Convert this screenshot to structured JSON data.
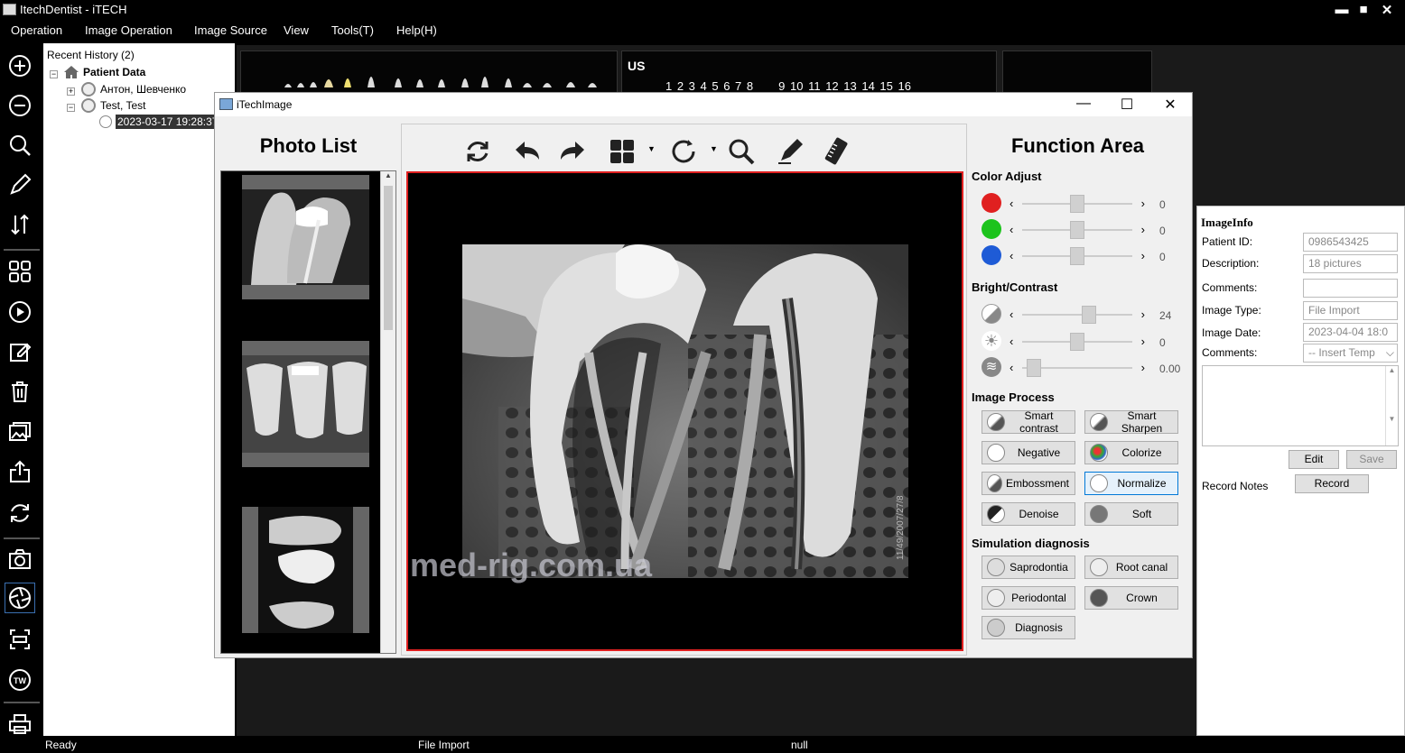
{
  "window": {
    "title": "ItechDentist - iTECH",
    "minimize": "▬",
    "maximize": "■",
    "close": "✕"
  },
  "menu": [
    "Operation",
    "Image Operation",
    "Image Source",
    "View",
    "Tools(T)",
    "Help(H)"
  ],
  "left_toolbar": [
    "add-icon",
    "zoom-out-icon",
    "search-icon",
    "pencil-icon",
    "sort-icon",
    "grid-icon",
    "play-icon",
    "edit-icon",
    "trash-icon",
    "gallery-icon",
    "export-icon",
    "refresh-icon",
    "camera-icon",
    "aperture-icon",
    "scanner-icon",
    "tw-icon",
    "printer-icon"
  ],
  "tree": {
    "header": "Recent History (2)",
    "root": "Patient Data",
    "patients": [
      "Антон, Шевченко",
      "Test, Test"
    ],
    "selected_date": "2023-03-17 19:28:37"
  },
  "preview": {
    "region": "US",
    "teeth_numbers": "1 2 3 4 5 6 7 8     9 10 11 12 13 14 15 16"
  },
  "dialog": {
    "title": "iTechImage",
    "photo_list_title": "Photo List",
    "function_area_title": "Function Area",
    "toolbar": [
      "refresh-icon",
      "undo-icon",
      "redo-icon",
      "layout-grid-icon",
      "rotate-icon",
      "magnifier-icon",
      "draw-icon",
      "ruler-icon"
    ],
    "watermark": "med-rig.com.ua",
    "color_adjust": {
      "label": "Color Adjust",
      "rows": [
        {
          "color": "#e02020",
          "value": "0",
          "level": 0.5
        },
        {
          "color": "#1cc31c",
          "value": "0",
          "level": 0.5
        },
        {
          "color": "#1e5bd6",
          "value": "0",
          "level": 0.5
        }
      ]
    },
    "bright_contrast": {
      "label": "Bright/Contrast",
      "rows": [
        {
          "icon": "contrast-icon",
          "value": "24",
          "level": 0.62
        },
        {
          "icon": "brightness-icon",
          "value": "0",
          "level": 0.5
        },
        {
          "icon": "gamma-icon",
          "value": "0.00",
          "level": 0.05
        }
      ]
    },
    "image_process": {
      "label": "Image Process",
      "buttons": [
        "Smart contrast",
        "Smart Sharpen",
        "Negative",
        "Colorize",
        "Embossment",
        "Normalize",
        "Denoise",
        "Soft"
      ]
    },
    "simulation": {
      "label": "Simulation diagnosis",
      "buttons": [
        "Saprodontia",
        "Root canal",
        "Periodontal",
        "Crown",
        "Diagnosis"
      ]
    },
    "window_controls": {
      "minimize": "—",
      "maximize": "☐",
      "close": "✕"
    }
  },
  "image_info": {
    "title": "ImageInfo",
    "fields": [
      {
        "label": "Patient ID:",
        "value": "0986543425"
      },
      {
        "label": "Description:",
        "value": "18 pictures"
      },
      {
        "label": "Comments:",
        "value": ""
      },
      {
        "label": "Image Type:",
        "value": "File Import"
      },
      {
        "label": "Image Date:",
        "value": "2023-04-04 18:0"
      },
      {
        "label": "Comments:",
        "value": "-- Insert Temp"
      }
    ],
    "edit": "Edit",
    "save": "Save",
    "record_notes_label": "Record Notes",
    "record": "Record"
  },
  "status": {
    "left": "Ready",
    "middle": "File Import",
    "right": "null"
  }
}
